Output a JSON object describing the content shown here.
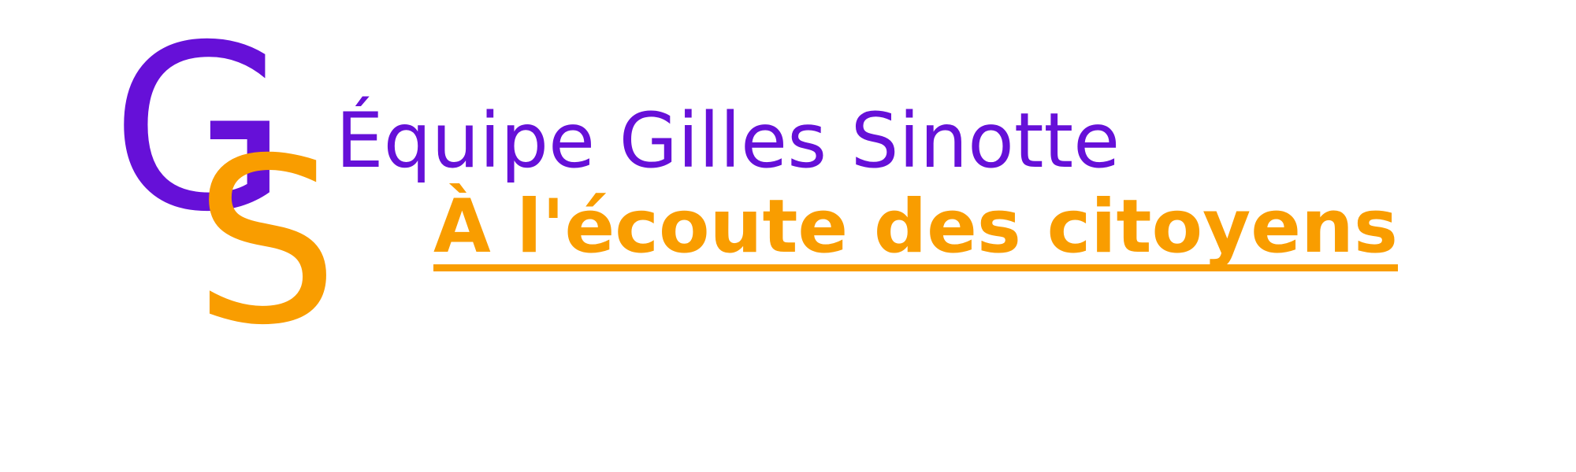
{
  "logo": {
    "initial_1": "G",
    "initial_2": "S"
  },
  "header": {
    "title": "Équipe Gilles Sinotte",
    "tagline": "À l'écoute des citoyens"
  },
  "colors": {
    "purple": "#6610d8",
    "orange": "#f99d00",
    "background": "#ffffff"
  }
}
